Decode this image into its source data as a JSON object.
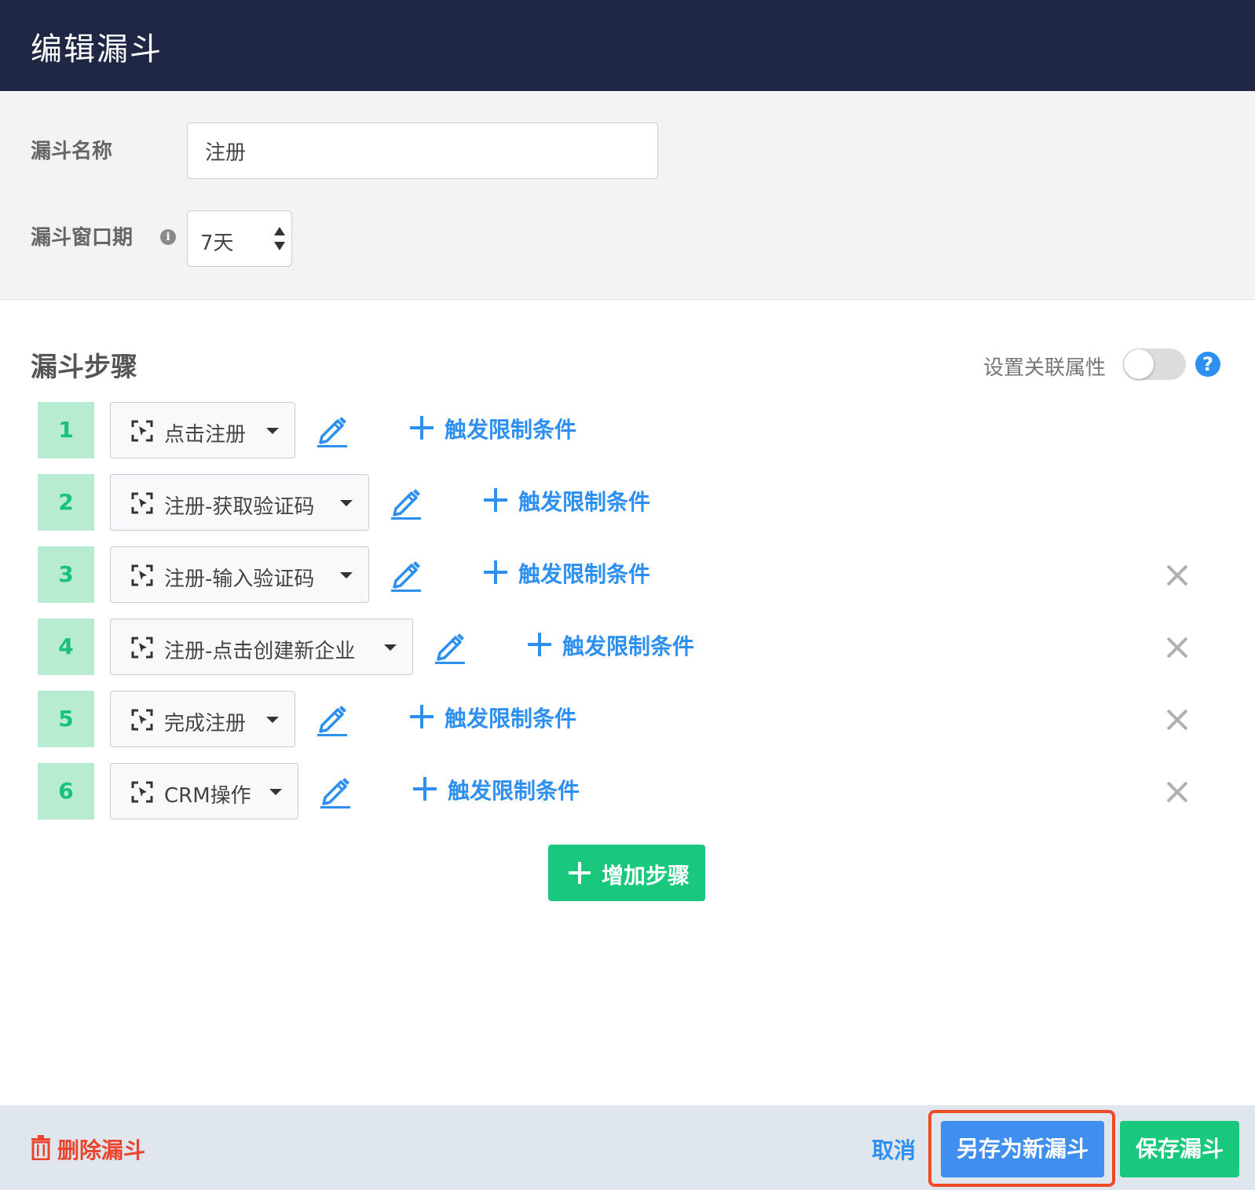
{
  "header": {
    "title": "编辑漏斗"
  },
  "settings": {
    "name_label": "漏斗名称",
    "name_value": "注册",
    "window_label": "漏斗窗口期",
    "window_value": "7天"
  },
  "steps_section": {
    "title": "漏斗步骤",
    "assoc_label": "设置关联属性",
    "assoc_enabled": false
  },
  "steps": [
    {
      "number": "1",
      "event": "点击注册",
      "trigger_label": "触发限制条件",
      "removable": false
    },
    {
      "number": "2",
      "event": "注册-获取验证码",
      "trigger_label": "触发限制条件",
      "removable": false
    },
    {
      "number": "3",
      "event": "注册-输入验证码",
      "trigger_label": "触发限制条件",
      "removable": true
    },
    {
      "number": "4",
      "event": "注册-点击创建新企业",
      "trigger_label": "触发限制条件",
      "removable": true
    },
    {
      "number": "5",
      "event": "完成注册",
      "trigger_label": "触发限制条件",
      "removable": true
    },
    {
      "number": "6",
      "event": "CRM操作",
      "trigger_label": "触发限制条件",
      "removable": true
    }
  ],
  "add_step_label": "增加步骤",
  "footer": {
    "delete_label": "删除漏斗",
    "cancel_label": "取消",
    "save_as_label": "另存为新漏斗",
    "save_label": "保存漏斗"
  },
  "colors": {
    "header_bg": "#1f2744",
    "accent_blue": "#2d8ff0",
    "accent_green": "#19c87d",
    "step_badge_bg": "#b8ecd2",
    "danger_red": "#e8452c",
    "highlight_red": "#ee4a25"
  }
}
